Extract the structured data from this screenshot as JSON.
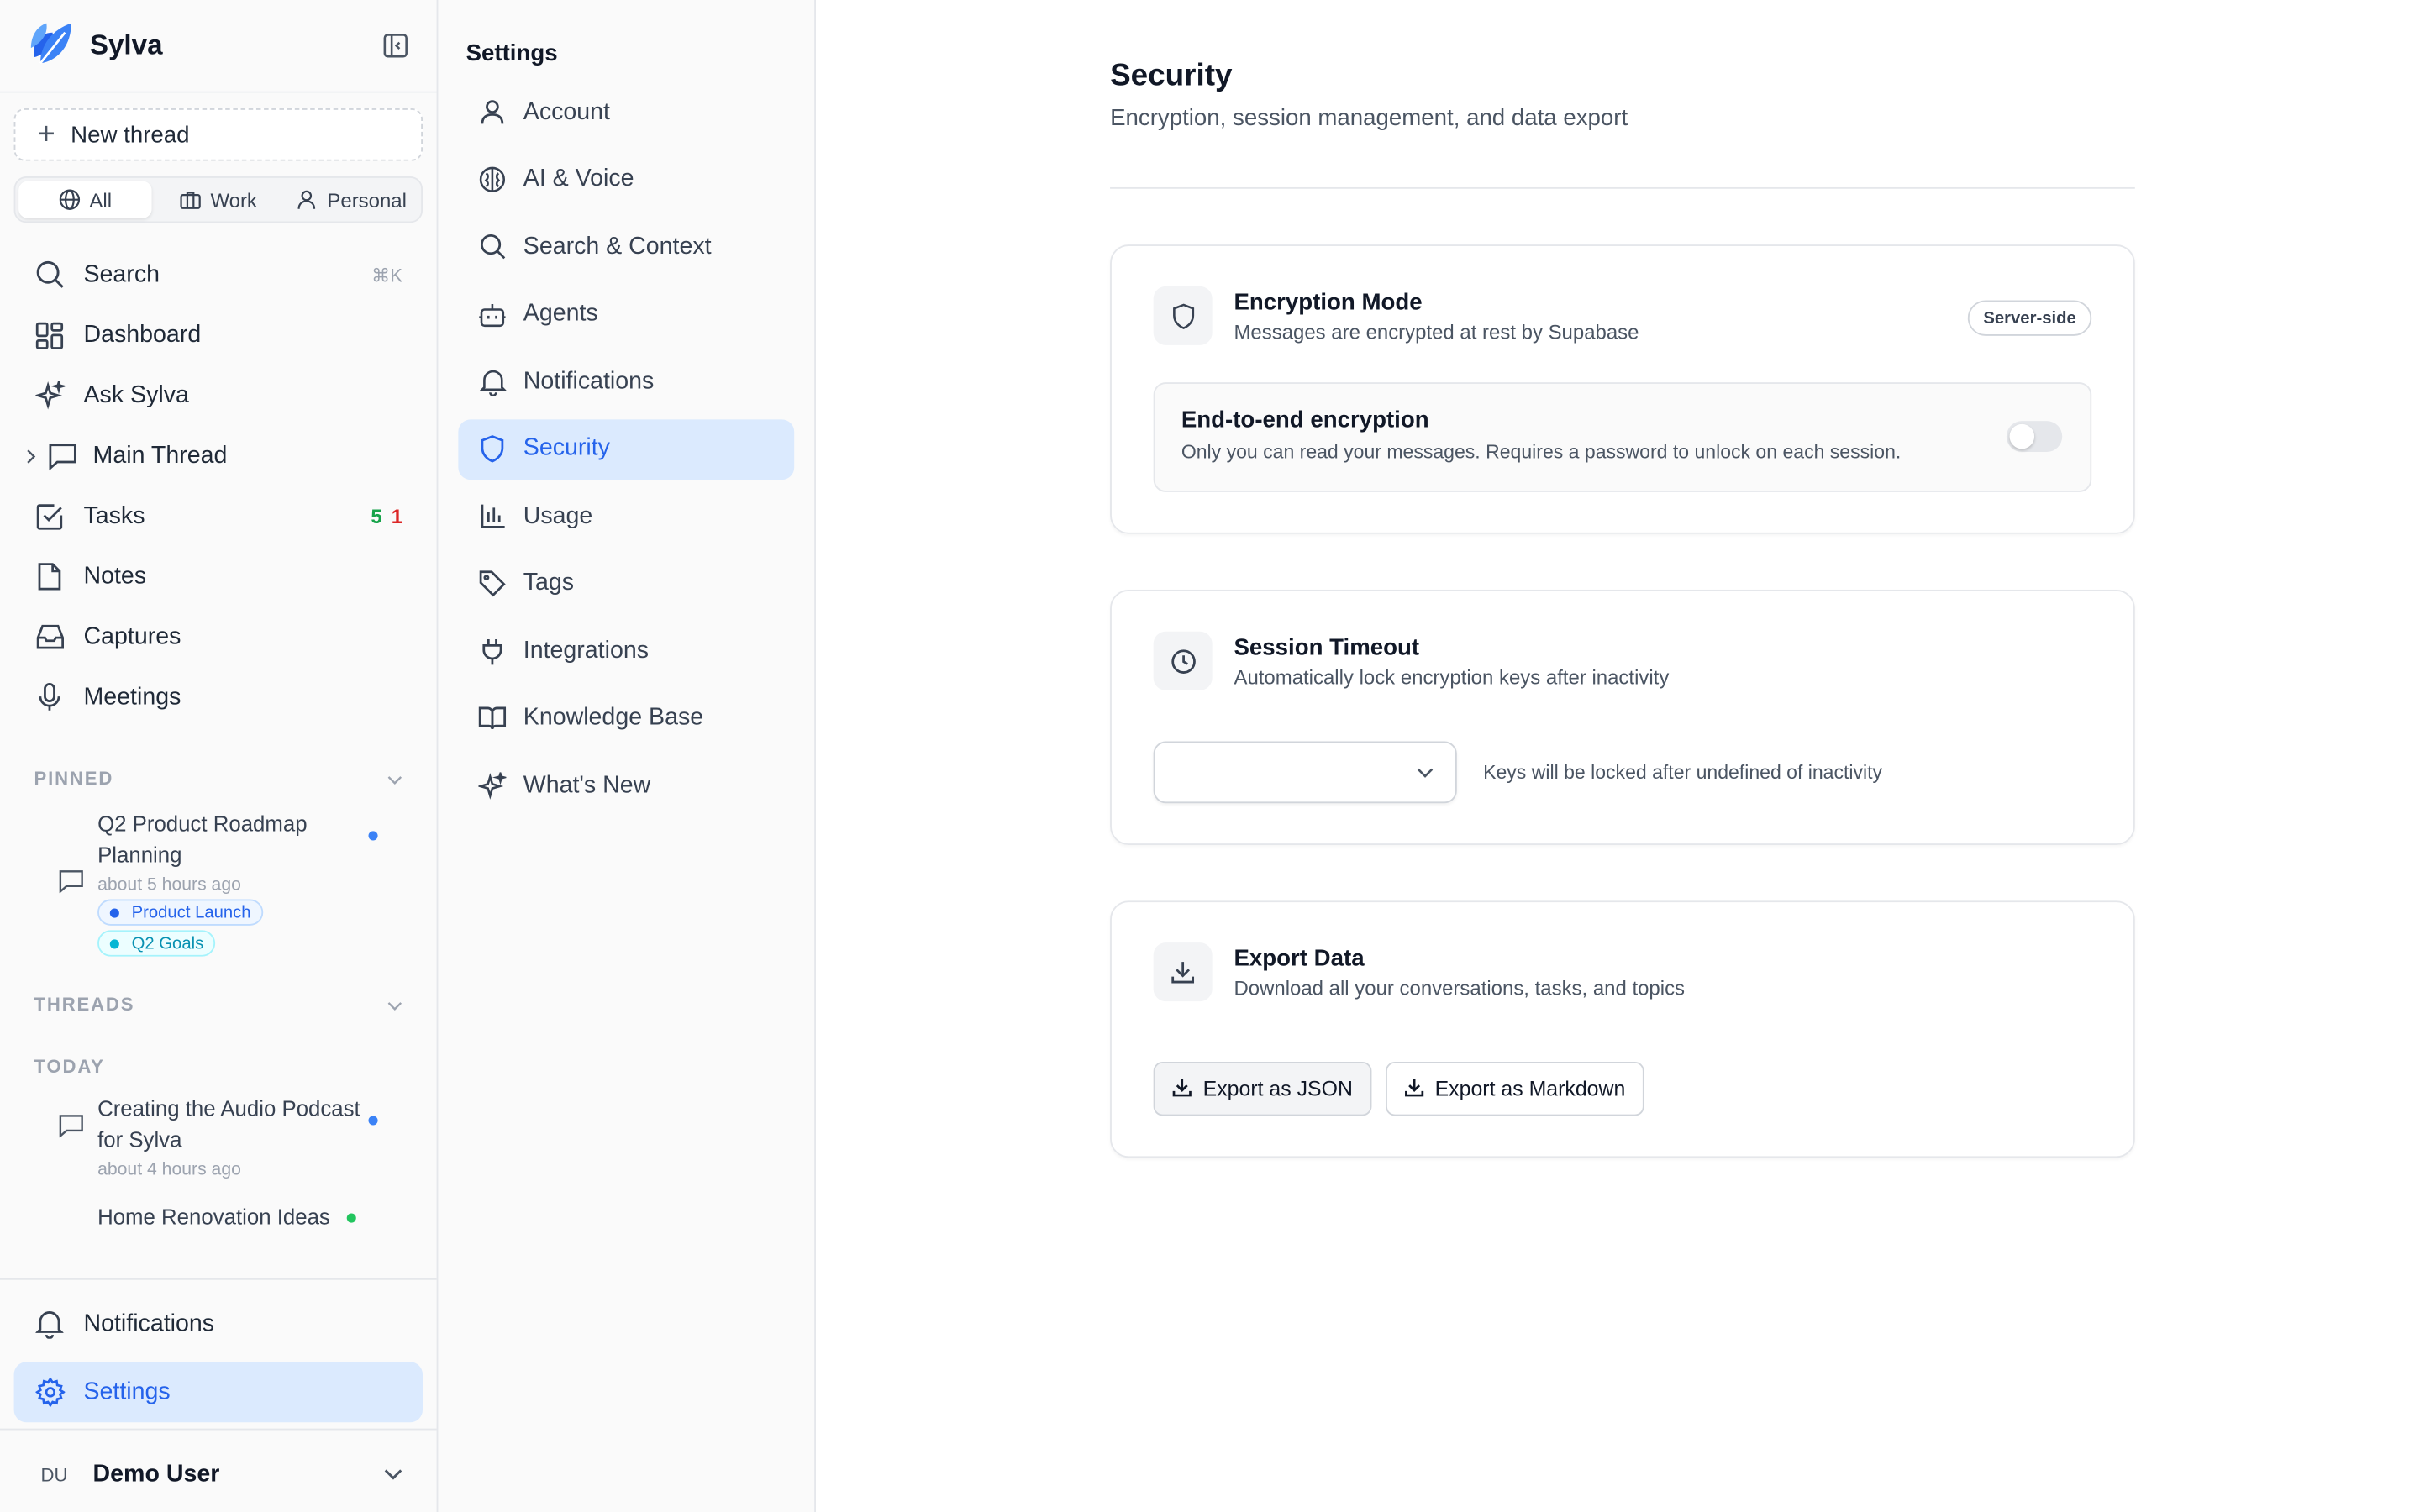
{
  "app": {
    "name": "Sylva",
    "new_thread_label": "New thread"
  },
  "scope_filter": [
    {
      "label": "All",
      "icon": "globe-icon",
      "active": true
    },
    {
      "label": "Work",
      "icon": "briefcase-icon",
      "active": false
    },
    {
      "label": "Personal",
      "icon": "user-icon",
      "active": false
    }
  ],
  "nav": {
    "search": {
      "label": "Search",
      "shortcut": "⌘K"
    },
    "dashboard": {
      "label": "Dashboard"
    },
    "ask": {
      "label": "Ask Sylva"
    },
    "main_thread": {
      "label": "Main Thread"
    },
    "tasks": {
      "label": "Tasks",
      "count_green": "5",
      "count_red": "1"
    },
    "notes": {
      "label": "Notes"
    },
    "captures": {
      "label": "Captures"
    },
    "meetings": {
      "label": "Meetings"
    }
  },
  "pinned": {
    "heading": "PINNED",
    "items": [
      {
        "title": "Q2 Product Roadmap Planning",
        "time": "about 5 hours ago",
        "tags": [
          "Product Launch",
          "Q2 Goals"
        ]
      }
    ]
  },
  "threads": {
    "heading": "THREADS",
    "group_today": "TODAY",
    "items": [
      {
        "title": "Creating the Audio Podcast for Sylva",
        "time": "about 4 hours ago"
      },
      {
        "title": "Home Renovation Ideas"
      }
    ]
  },
  "bottom": {
    "notifications": "Notifications",
    "settings": "Settings",
    "user_initials": "DU",
    "user_name": "Demo User"
  },
  "settings_nav": {
    "title": "Settings",
    "items": [
      {
        "label": "Account",
        "icon": "user-icon"
      },
      {
        "label": "AI & Voice",
        "icon": "brain-icon"
      },
      {
        "label": "Search & Context",
        "icon": "search-icon"
      },
      {
        "label": "Agents",
        "icon": "bot-icon"
      },
      {
        "label": "Notifications",
        "icon": "bell-icon"
      },
      {
        "label": "Security",
        "icon": "shield-icon",
        "active": true
      },
      {
        "label": "Usage",
        "icon": "bar-chart-icon"
      },
      {
        "label": "Tags",
        "icon": "tag-icon"
      },
      {
        "label": "Integrations",
        "icon": "plug-icon"
      },
      {
        "label": "Knowledge Base",
        "icon": "book-icon"
      },
      {
        "label": "What's New",
        "icon": "sparkles-icon"
      }
    ]
  },
  "security": {
    "title": "Security",
    "subtitle": "Encryption, session management, and data export",
    "encryption": {
      "title": "Encryption Mode",
      "subtitle": "Messages are encrypted at rest by Supabase",
      "badge": "Server-side",
      "e2e_title": "End-to-end encryption",
      "e2e_subtitle": "Only you can read your messages. Requires a password to unlock on each session.",
      "e2e_enabled": false
    },
    "session": {
      "title": "Session Timeout",
      "subtitle": "Automatically lock encryption keys after inactivity",
      "select_value": "",
      "hint": "Keys will be locked after undefined of inactivity"
    },
    "export": {
      "title": "Export Data",
      "subtitle": "Download all your conversations, tasks, and topics",
      "json_label": "Export as JSON",
      "markdown_label": "Export as Markdown"
    }
  },
  "colors": {
    "accent": "#2563eb",
    "active_bg": "#dbeafe",
    "count_green": "#16a34a",
    "count_red": "#dc2626"
  }
}
